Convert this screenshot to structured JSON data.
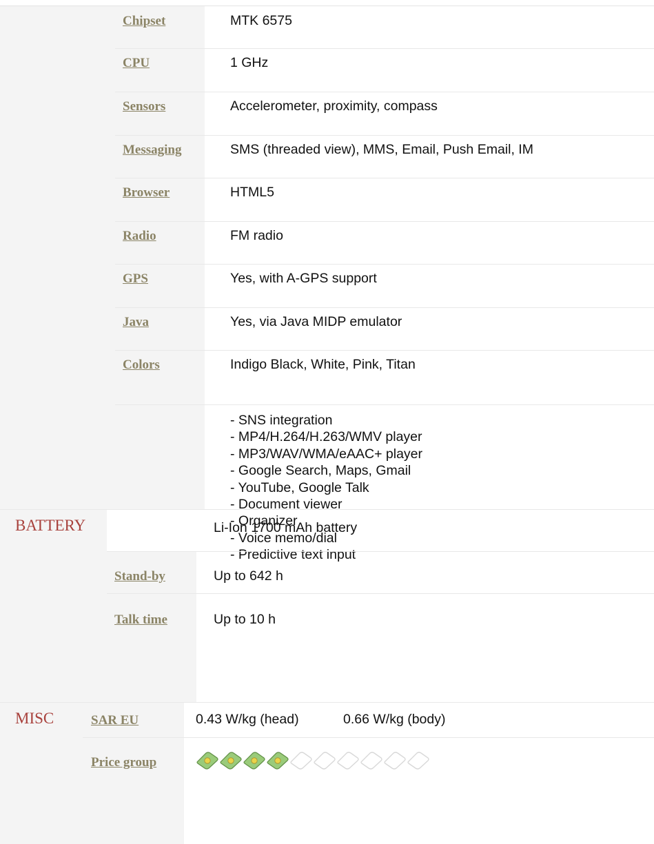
{
  "specs": [
    {
      "label": "Chipset",
      "value": "MTK 6575"
    },
    {
      "label": "CPU",
      "value": "1 GHz"
    },
    {
      "label": "Sensors",
      "value": "Accelerometer, proximity, compass"
    },
    {
      "label": "Messaging",
      "value": "SMS (threaded view), MMS, Email, Push Email, IM"
    },
    {
      "label": "Browser",
      "value": "HTML5"
    },
    {
      "label": "Radio",
      "value": "FM radio"
    },
    {
      "label": "GPS",
      "value": "Yes, with A-GPS support"
    },
    {
      "label": "Java",
      "value": "Yes, via Java MIDP emulator"
    },
    {
      "label": "Colors",
      "value": "Indigo Black, White, Pink, Titan"
    }
  ],
  "features": [
    "- SNS integration",
    "- MP4/H.264/H.263/WMV player",
    "- MP3/WAV/WMA/eAAC+ player",
    "- Google Search, Maps, Gmail",
    "- YouTube, Google Talk",
    "- Document viewer",
    "- Organizer",
    "- Voice memo/dial",
    "- Predictive text input"
  ],
  "battery": {
    "section": "BATTERY",
    "summary": "Li-Ion 1700 mAh battery",
    "standby_label": "Stand-by",
    "standby_value": "Up to 642 h",
    "talk_label": "Talk time",
    "talk_value": "Up to 10 h"
  },
  "misc": {
    "section": "MISC",
    "sar_label": "SAR EU",
    "sar_head": "0.43 W/kg (head)",
    "sar_body": "0.66 W/kg (body)",
    "price_label": "Price group",
    "price_filled": 4,
    "price_total": 10
  },
  "colors": {
    "label": "#8b8466",
    "section": "#a8413c",
    "stripe": "#f4f4f4"
  }
}
